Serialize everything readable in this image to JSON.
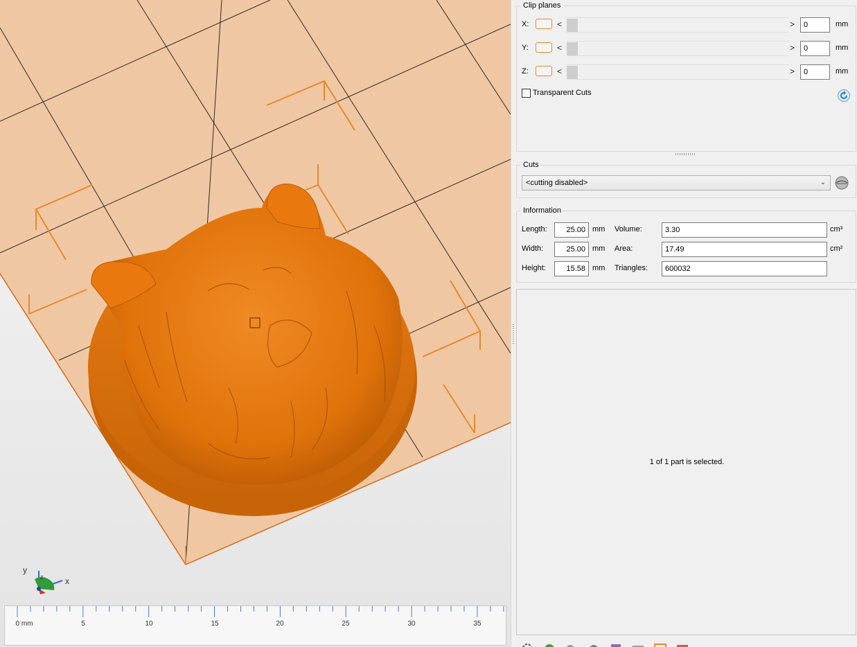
{
  "viewport": {
    "ruler": {
      "unit_label": "0 mm",
      "ticks": [
        "5",
        "10",
        "15",
        "20",
        "25",
        "30",
        "35"
      ]
    },
    "axes": {
      "x": "x",
      "y": "y",
      "z": "z"
    }
  },
  "clip_planes": {
    "title": "Clip planes",
    "rows": [
      {
        "axis": "X:",
        "value": "0",
        "unit": "mm"
      },
      {
        "axis": "Y:",
        "value": "0",
        "unit": "mm"
      },
      {
        "axis": "Z:",
        "value": "0",
        "unit": "mm"
      }
    ],
    "left_arrow": "<",
    "right_arrow": ">",
    "transparent_cuts_label": "Transparent Cuts"
  },
  "cuts": {
    "title": "Cuts",
    "selected": "<cutting disabled>"
  },
  "information": {
    "title": "Information",
    "length_label": "Length:",
    "length_value": "25.00",
    "length_unit": "mm",
    "width_label": "Width:",
    "width_value": "25.00",
    "width_unit": "mm",
    "height_label": "Height:",
    "height_value": "15.58",
    "height_unit": "mm",
    "volume_label": "Volume:",
    "volume_value": "3.30",
    "volume_unit": "cm³",
    "area_label": "Area:",
    "area_value": "17.49",
    "area_unit": "cm²",
    "triangles_label": "Triangles:",
    "triangles_value": "600032"
  },
  "status": {
    "selection": "1 of 1 part is selected."
  },
  "colors": {
    "accent": "#e58a2c",
    "model": "#e8780e",
    "plate": "#f0c7a3"
  }
}
